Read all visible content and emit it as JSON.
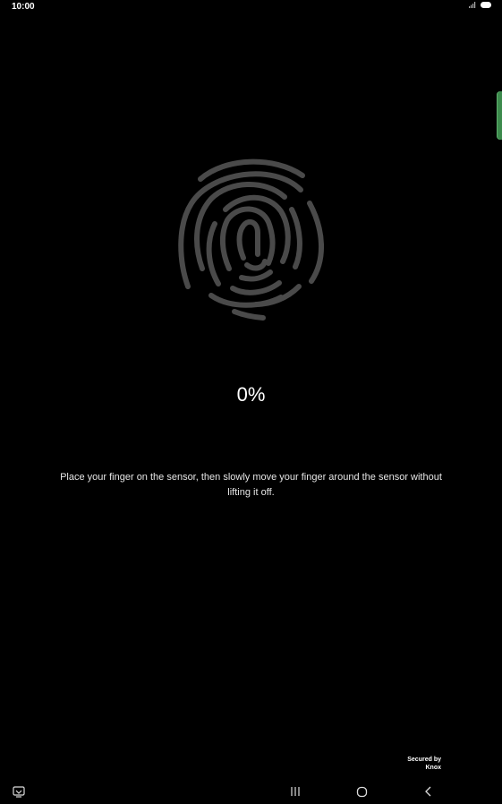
{
  "status_bar": {
    "time": "10:00",
    "icons": [
      "signal-icon",
      "battery-icon"
    ]
  },
  "enrollment": {
    "progress_text": "0%",
    "progress": 0,
    "instruction": "Place your finger on the sensor, then slowly move your finger around the sensor without lifting it off."
  },
  "footer": {
    "secured_line1": "Secured by",
    "secured_line2": "Knox"
  },
  "navigation": {
    "items": [
      "keyboard-hide-icon",
      "recent-apps-icon",
      "home-icon",
      "back-icon"
    ]
  },
  "colors": {
    "background": "#000000",
    "fingerprint": "#4a4a4a",
    "edge_handle": "#3c8a4c"
  }
}
